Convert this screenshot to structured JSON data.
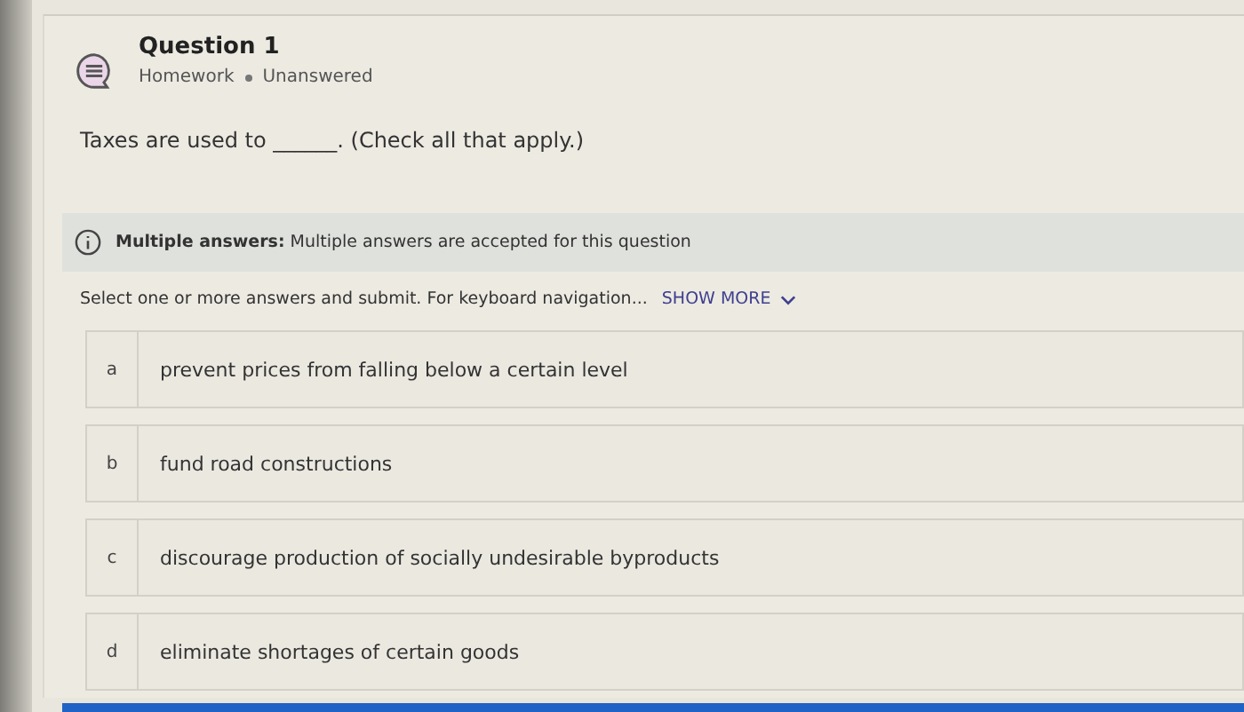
{
  "question": {
    "title": "Question 1",
    "meta": [
      "Homework",
      "Unanswered"
    ]
  },
  "prompt": "Taxes are used to ______. (Check all that apply.)",
  "info": {
    "label": "Multiple answers:",
    "text": "Multiple answers are accepted for this question"
  },
  "instructions": "Select one or more answers and submit. For keyboard navigation...",
  "show_more": "SHOW MORE",
  "options": [
    {
      "key": "a",
      "text": "prevent prices from falling below a certain level",
      "selected": false
    },
    {
      "key": "b",
      "text": "fund road constructions",
      "selected": false
    },
    {
      "key": "c",
      "text": "discourage production of socially undesirable byproducts",
      "selected": false
    },
    {
      "key": "d",
      "text": "eliminate shortages of certain goods",
      "selected": false
    }
  ]
}
